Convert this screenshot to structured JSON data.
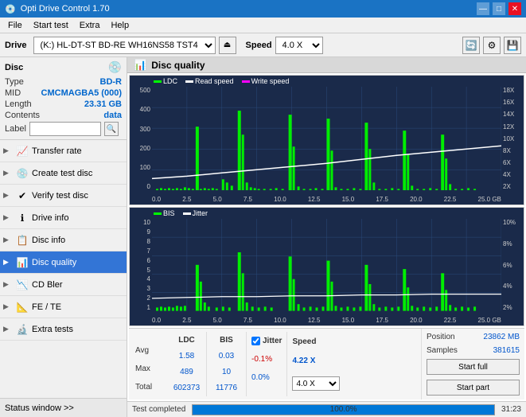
{
  "app": {
    "title": "Opti Drive Control 1.70",
    "icon": "💿"
  },
  "titlebar": {
    "minimize": "—",
    "maximize": "□",
    "close": "✕"
  },
  "menu": {
    "items": [
      "File",
      "Start test",
      "Extra",
      "Help"
    ]
  },
  "drive": {
    "label": "Drive",
    "device": "(K:)  HL-DT-ST BD-RE  WH16NS58 TST4",
    "speed_label": "Speed",
    "speed": "4.0 X"
  },
  "disc": {
    "title": "Disc",
    "type_label": "Type",
    "type_val": "BD-R",
    "mid_label": "MID",
    "mid_val": "CMCMAGBA5 (000)",
    "length_label": "Length",
    "length_val": "23.31 GB",
    "contents_label": "Contents",
    "contents_val": "data",
    "label_label": "Label",
    "label_placeholder": ""
  },
  "nav": {
    "items": [
      {
        "id": "transfer-rate",
        "label": "Transfer rate",
        "icon": "📈"
      },
      {
        "id": "create-test-disc",
        "label": "Create test disc",
        "icon": "💿"
      },
      {
        "id": "verify-test-disc",
        "label": "Verify test disc",
        "icon": "✔"
      },
      {
        "id": "drive-info",
        "label": "Drive info",
        "icon": "ℹ"
      },
      {
        "id": "disc-info",
        "label": "Disc info",
        "icon": "📋"
      },
      {
        "id": "disc-quality",
        "label": "Disc quality",
        "icon": "📊",
        "active": true
      },
      {
        "id": "cd-bler",
        "label": "CD Bler",
        "icon": "📉"
      },
      {
        "id": "fe-te",
        "label": "FE / TE",
        "icon": "📐"
      },
      {
        "id": "extra-tests",
        "label": "Extra tests",
        "icon": "🔬"
      }
    ]
  },
  "status_window": "Status window >>",
  "content": {
    "title": "Disc quality",
    "icon": "📊"
  },
  "chart1": {
    "title": "LDC",
    "legend": [
      {
        "label": "LDC",
        "color": "#00ff00"
      },
      {
        "label": "Read speed",
        "color": "#ffffff"
      },
      {
        "label": "Write speed",
        "color": "#ff00ff"
      }
    ],
    "y_left": [
      "500",
      "400",
      "300",
      "200",
      "100",
      "0"
    ],
    "y_right": [
      "18X",
      "16X",
      "14X",
      "12X",
      "10X",
      "8X",
      "6X",
      "4X",
      "2X"
    ],
    "x_labels": [
      "0.0",
      "2.5",
      "5.0",
      "7.5",
      "10.0",
      "12.5",
      "15.0",
      "17.5",
      "20.0",
      "22.5",
      "25.0 GB"
    ]
  },
  "chart2": {
    "title": "BIS",
    "legend": [
      {
        "label": "BIS",
        "color": "#00ff00"
      },
      {
        "label": "Jitter",
        "color": "#ffffff"
      }
    ],
    "y_left": [
      "10",
      "9",
      "8",
      "7",
      "6",
      "5",
      "4",
      "3",
      "2",
      "1"
    ],
    "y_right": [
      "10%",
      "8%",
      "6%",
      "4%",
      "2%"
    ],
    "x_labels": [
      "0.0",
      "2.5",
      "5.0",
      "7.5",
      "10.0",
      "12.5",
      "15.0",
      "17.5",
      "20.0",
      "22.5",
      "25.0 GB"
    ]
  },
  "stats": {
    "ldc_label": "LDC",
    "bis_label": "BIS",
    "jitter_label": "Jitter",
    "speed_label": "Speed",
    "avg_label": "Avg",
    "max_label": "Max",
    "total_label": "Total",
    "ldc_avg": "1.58",
    "ldc_max": "489",
    "ldc_total": "602373",
    "bis_avg": "0.03",
    "bis_max": "10",
    "bis_total": "11776",
    "jitter_avg": "-0.1%",
    "jitter_max": "0.0%",
    "jitter_total": "",
    "speed_val": "4.22 X",
    "speed_select": "4.0 X",
    "position_label": "Position",
    "position_val": "23862 MB",
    "samples_label": "Samples",
    "samples_val": "381615",
    "start_full": "Start full",
    "start_part": "Start part"
  },
  "progress": {
    "status": "Test completed",
    "percent": "100.0%",
    "percent_num": 100,
    "time": "31:23"
  },
  "colors": {
    "accent": "#0066cc",
    "active_nav": "#3375d6",
    "chart_bg": "#1a2a4a",
    "grid": "#2a4a7a",
    "ldc_bar": "#00ee00",
    "speed_line": "#ffffff",
    "jitter_line": "#ffffff",
    "bis_bar": "#00ee00"
  }
}
